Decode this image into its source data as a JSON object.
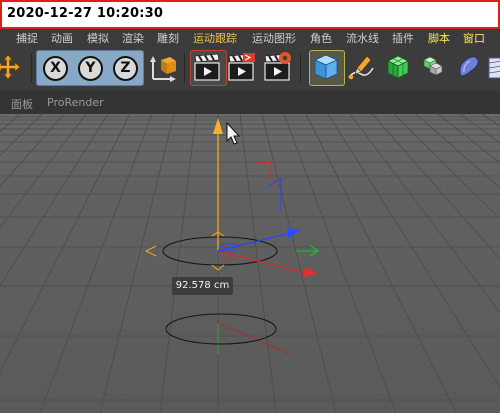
{
  "timestamp": "2020-12-27  10:20:30",
  "menu": {
    "items": [
      {
        "label": "捕捉",
        "style": "normal"
      },
      {
        "label": "动画",
        "style": "normal"
      },
      {
        "label": "模拟",
        "style": "normal"
      },
      {
        "label": "渲染",
        "style": "normal"
      },
      {
        "label": "雕刻",
        "style": "normal"
      },
      {
        "label": "运动跟踪",
        "style": "highlight"
      },
      {
        "label": "运动图形",
        "style": "normal"
      },
      {
        "label": "角色",
        "style": "normal"
      },
      {
        "label": "流水线",
        "style": "normal"
      },
      {
        "label": "插件",
        "style": "normal"
      },
      {
        "label": "脚本",
        "style": "yellow"
      },
      {
        "label": "窗口",
        "style": "yellow"
      }
    ]
  },
  "toolbar": {
    "axis_x": "X",
    "axis_y": "Y",
    "axis_z": "Z",
    "icons": [
      "move-icon",
      "lock-x-icon",
      "lock-y-icon",
      "lock-z-icon",
      "coordinate-system-icon",
      "render-view-icon",
      "render-picture-viewer-icon",
      "render-settings-icon",
      "cube-icon",
      "pen-icon",
      "subdivision-icon",
      "array-icon",
      "deformer-icon",
      "floor-icon"
    ]
  },
  "panel": {
    "item1": "面板",
    "item2": "ProRender"
  },
  "viewport": {
    "measure": "92.578 cm"
  },
  "colors": {
    "timestamp_border": "#e41b1b",
    "menu_highlight": "#f0c44a",
    "axis_y": "#f5a623",
    "axis_x": "#e02020",
    "axis_z": "#2446ff",
    "axis_green": "#1fb53a"
  }
}
